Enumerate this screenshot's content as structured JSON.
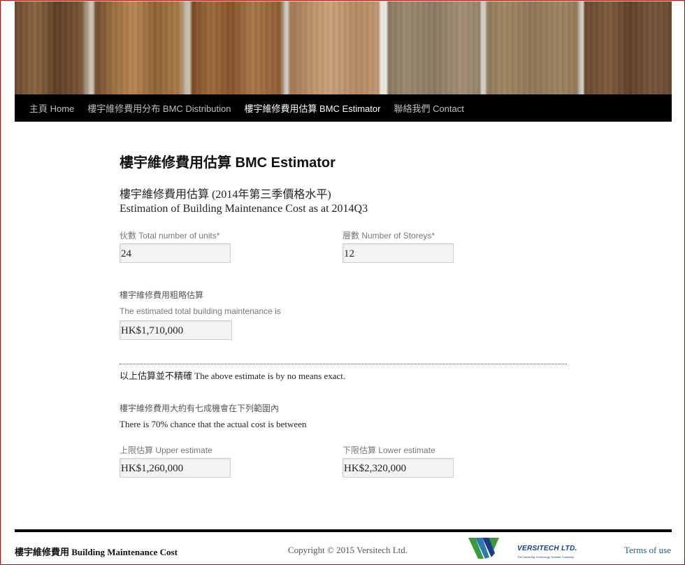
{
  "nav": {
    "items": [
      {
        "label": "主頁 Home",
        "active": false
      },
      {
        "label": "樓宇維修費用分布 BMC Distribution",
        "active": false
      },
      {
        "label": "樓宇維修費用估算 BMC Estimator",
        "active": true
      },
      {
        "label": "聯絡我們 Contact",
        "active": false
      }
    ]
  },
  "page": {
    "title": "樓宇維修費用估算 BMC Estimator",
    "subtitle_zh": "樓宇維修費用估算 (2014年第三季價格水平)",
    "subtitle_en": "Estimation of Building Maintenance Cost as at 2014Q3"
  },
  "form": {
    "units_label": "伙數 Total number of units*",
    "units_value": "24",
    "storeys_label": "層數 Number of Storeys*",
    "storeys_value": "12"
  },
  "result": {
    "label_zh": "樓宇維修費用粗略估算",
    "label_en": "The estimated total building maintenance is",
    "value": "HK$1,710,000",
    "disclaimer": "以上估算並不精確 The above estimate is by no means exact."
  },
  "range": {
    "intro_zh": "樓宇維修費用大約有七成機會在下列範圍內",
    "intro_en": "There is 70% chance that the actual cost is between",
    "upper_label": "上限估算 Upper estimate",
    "upper_value": "HK$1,260,000",
    "lower_label": "下限估算 Lower estimate",
    "lower_value": "HK$2,320,000"
  },
  "footer": {
    "site_name": "樓宇維修費用 Building Maintenance Cost",
    "copyright": "Copyright © 2015 Versitech Ltd.",
    "logo_text": "VERSITECH LTD.",
    "logo_tagline": "The University Technology Transfer Company",
    "terms_label": "Terms of use"
  },
  "colors": {
    "nav_bg": "#000000",
    "nav_text": "#bfbfbf",
    "nav_active": "#ffffff",
    "link": "#1b5e8c",
    "logo_blue": "#1a3a8a",
    "logo_green": "#3a9b3a",
    "frame": "#c00000"
  },
  "icons": {
    "logo": "versitech-logo-icon"
  }
}
